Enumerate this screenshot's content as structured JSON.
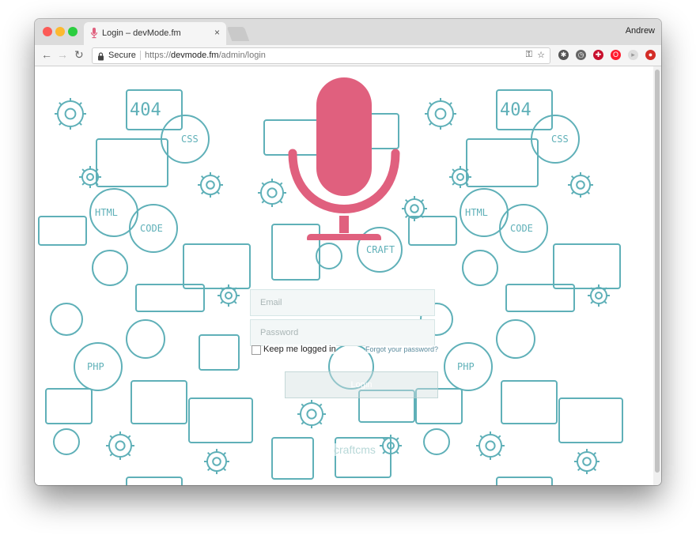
{
  "browser": {
    "tab_title": "Login – devMode.fm",
    "user_name": "Andrew",
    "secure_label": "Secure",
    "url_scheme": "https://",
    "url_domain": "devmode.fm",
    "url_path": "/admin/login",
    "icons": [
      "back-arrow-icon",
      "forward-arrow-icon",
      "reload-icon",
      "lock-icon",
      "key-icon",
      "star-icon",
      "settings-icon",
      "clock-icon",
      "ublock-icon",
      "opera-icon",
      "puzzle-icon",
      "lastpass-icon"
    ]
  },
  "login": {
    "email_placeholder": "Email",
    "password_placeholder": "Password",
    "remember_label": "Keep me logged in",
    "forgot_label": "Forgot your password?",
    "submit_label": "Login"
  },
  "footer": {
    "powered_by": "craftcms"
  },
  "pattern": {
    "labels": [
      "404",
      "CSS",
      "HTML",
      "CODE",
      "CRAFT",
      "PHP"
    ]
  },
  "colors": {
    "pattern": "#5fb0b8",
    "microphone": "#e0607e",
    "tab_favicon": "#e0607e"
  }
}
